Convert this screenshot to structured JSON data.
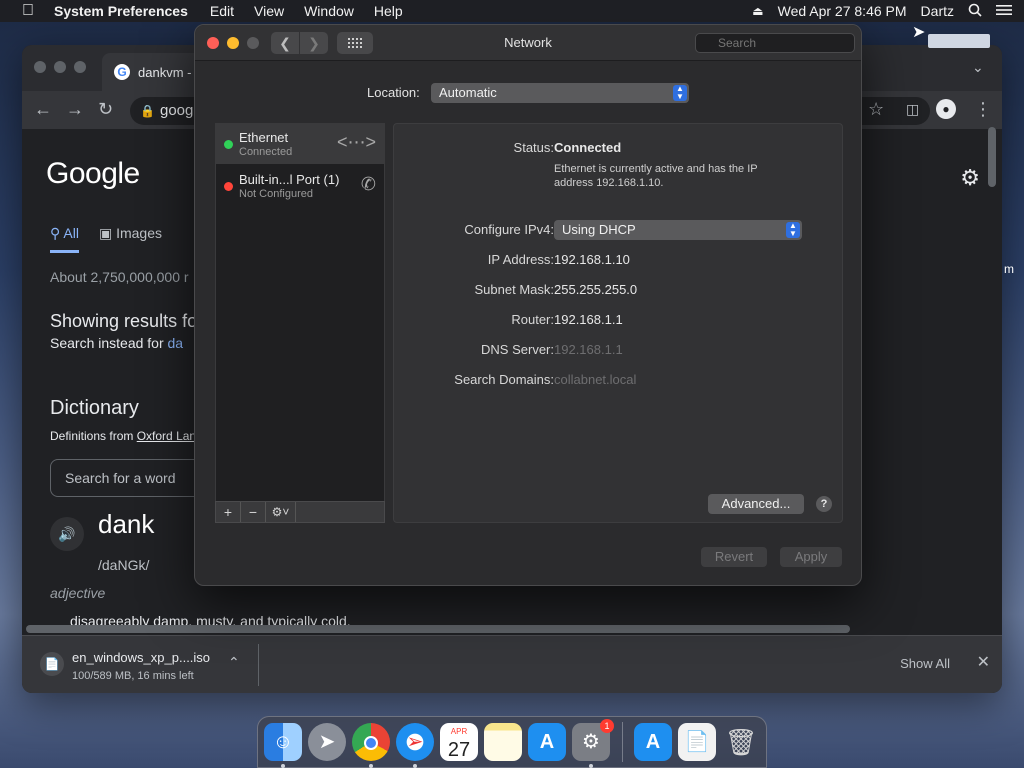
{
  "menubar": {
    "app": "System Preferences",
    "items": [
      "Edit",
      "View",
      "Window",
      "Help"
    ],
    "datetime": "Wed Apr 27  8:46 PM",
    "user": "Dartz"
  },
  "chrome": {
    "tab_title": "dankvm -",
    "omnibox": "goog",
    "google_logo": "Google",
    "tab_all": "All",
    "tab_images": "Images",
    "about": "About 2,750,000,000 r",
    "showing": "Showing results fo",
    "instead_prefix": "Search instead for",
    "instead_link": "da",
    "dictionary": "Dictionary",
    "definitions_prefix": "Definitions from",
    "definitions_link": "Oxford Lan",
    "word_search_placeholder": "Search for a word",
    "word": "dank",
    "phonetic": "/daNGk/",
    "part_of_speech": "adjective",
    "definition": "disagreeably damp, musty, and typically cold.",
    "download": {
      "filename": "en_windows_xp_p....iso",
      "progress": "100/589 MB, 16 mins left",
      "show_all": "Show All"
    }
  },
  "network": {
    "title": "Network",
    "search_placeholder": "Search",
    "location_label": "Location:",
    "location_value": "Automatic",
    "services": [
      {
        "name": "Ethernet",
        "status": "Connected",
        "color": "#30d158"
      },
      {
        "name": "Built-in...l Port (1)",
        "status": "Not Configured",
        "color": "#ff453a"
      }
    ],
    "status_label": "Status:",
    "status_value": "Connected",
    "status_desc": "Ethernet is currently active and has the IP address 192.168.1.10.",
    "configure_label": "Configure IPv4:",
    "configure_value": "Using DHCP",
    "ip_label": "IP Address:",
    "ip_value": "192.168.1.10",
    "subnet_label": "Subnet Mask:",
    "subnet_value": "255.255.255.0",
    "router_label": "Router:",
    "router_value": "192.168.1.1",
    "dns_label": "DNS Server:",
    "dns_value": "192.168.1.1",
    "domains_label": "Search Domains:",
    "domains_value": "collabnet.local",
    "advanced_label": "Advanced...",
    "help_label": "?",
    "revert_label": "Revert",
    "apply_label": "Apply"
  },
  "dock": {
    "calendar_month": "APR",
    "calendar_day": "27",
    "badge": "1"
  }
}
